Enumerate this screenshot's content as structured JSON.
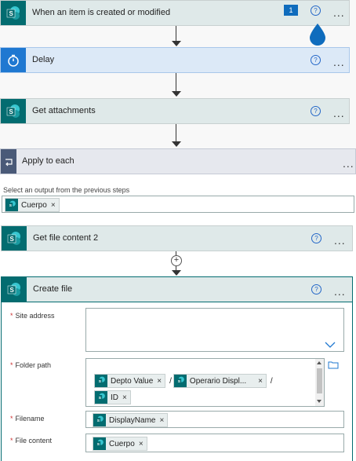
{
  "steps": {
    "trigger": {
      "title": "When an item is created or modified",
      "badge_count": "1"
    },
    "delay": {
      "title": "Delay"
    },
    "get_attachments": {
      "title": "Get attachments"
    },
    "apply_each": {
      "title": "Apply to each",
      "select_label": "Select an output from the previous steps",
      "token": "Cuerpo"
    },
    "get_file_content": {
      "title": "Get file content 2"
    },
    "create_file": {
      "title": "Create file",
      "site_address_label": "Site address",
      "folder_path_label": "Folder path",
      "filename_label": "Filename",
      "file_content_label": "File content",
      "folder_tokens": [
        "Depto Value",
        "Operario Displ...",
        "ID"
      ],
      "folder_separator": "/",
      "filename_token": "DisplayName",
      "file_content_token": "Cuerpo"
    }
  },
  "ui": {
    "help_glyph": "?",
    "more_glyph": "...",
    "remove_glyph": "×",
    "add_glyph": "+"
  },
  "colors": {
    "sharepoint": "#036c70",
    "delay": "#1f78d1",
    "loop": "#4a5a78",
    "accent": "#0f6cbd"
  }
}
